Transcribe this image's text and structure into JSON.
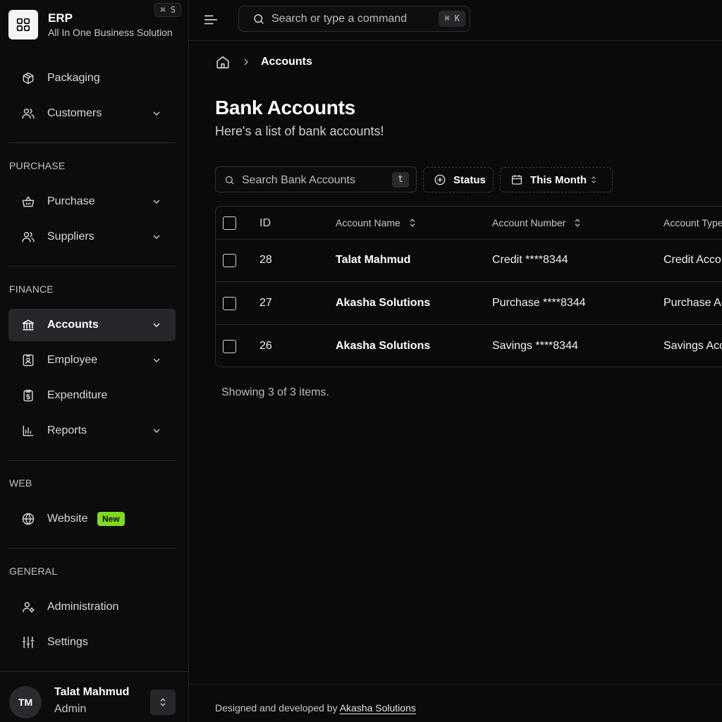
{
  "brand": {
    "name": "ERP",
    "subtitle": "All In One Business Solution",
    "shortcut": "⌘ S"
  },
  "sidebar": {
    "top_items": [
      {
        "label": "Packaging",
        "icon": "box-icon"
      },
      {
        "label": "Customers",
        "icon": "users-icon",
        "has_chevron": true
      }
    ],
    "sections": {
      "purchase": {
        "title": "PURCHASE",
        "items": [
          {
            "label": "Purchase",
            "icon": "basket-icon"
          },
          {
            "label": "Suppliers",
            "icon": "users-icon"
          }
        ]
      },
      "finance": {
        "title": "FINANCE",
        "items": [
          {
            "label": "Accounts",
            "icon": "bank-icon",
            "active": true
          },
          {
            "label": "Employee",
            "icon": "id-badge-icon"
          },
          {
            "label": "Expenditure",
            "icon": "receipt-icon"
          },
          {
            "label": "Reports",
            "icon": "bar-chart-icon"
          }
        ]
      },
      "web": {
        "title": "WEB",
        "items": [
          {
            "label": "Website",
            "icon": "globe-icon",
            "badge": "New"
          }
        ]
      },
      "general": {
        "title": "GENERAL",
        "items": [
          {
            "label": "Administration",
            "icon": "user-cog-icon"
          },
          {
            "label": "Settings",
            "icon": "sliders-icon"
          }
        ]
      }
    },
    "user": {
      "initials": "TM",
      "name": "Talat Mahmud",
      "role": "Admin"
    }
  },
  "topbar": {
    "search_placeholder": "Search or type a command",
    "search_shortcut": "⌘ K"
  },
  "breadcrumb": {
    "current": "Accounts"
  },
  "page": {
    "title": "Bank Accounts",
    "subtitle": "Here's a list of bank accounts!"
  },
  "toolbar": {
    "search_placeholder": "Search Bank Accounts",
    "search_shortcut": "t",
    "status_filter": "Status",
    "date_filter": "This Month"
  },
  "table": {
    "columns": [
      "ID",
      "Account Name",
      "Account Number",
      "Account Type"
    ],
    "rows": [
      {
        "id": "28",
        "name": "Talat Mahmud",
        "number": "Credit ****8344",
        "type": "Credit Account"
      },
      {
        "id": "27",
        "name": "Akasha Solutions",
        "number": "Purchase ****8344",
        "type": "Purchase Account"
      },
      {
        "id": "26",
        "name": "Akasha Solutions",
        "number": "Savings ****8344",
        "type": "Savings Account"
      }
    ],
    "summary": "Showing 3 of 3 items."
  },
  "footer": {
    "prefix": "Designed and developed by",
    "link": "Akasha Solutions"
  },
  "colors": {
    "accent_badge": "#7ddc1f",
    "active_bg": "#27272b",
    "background": "#0a0a0c"
  }
}
